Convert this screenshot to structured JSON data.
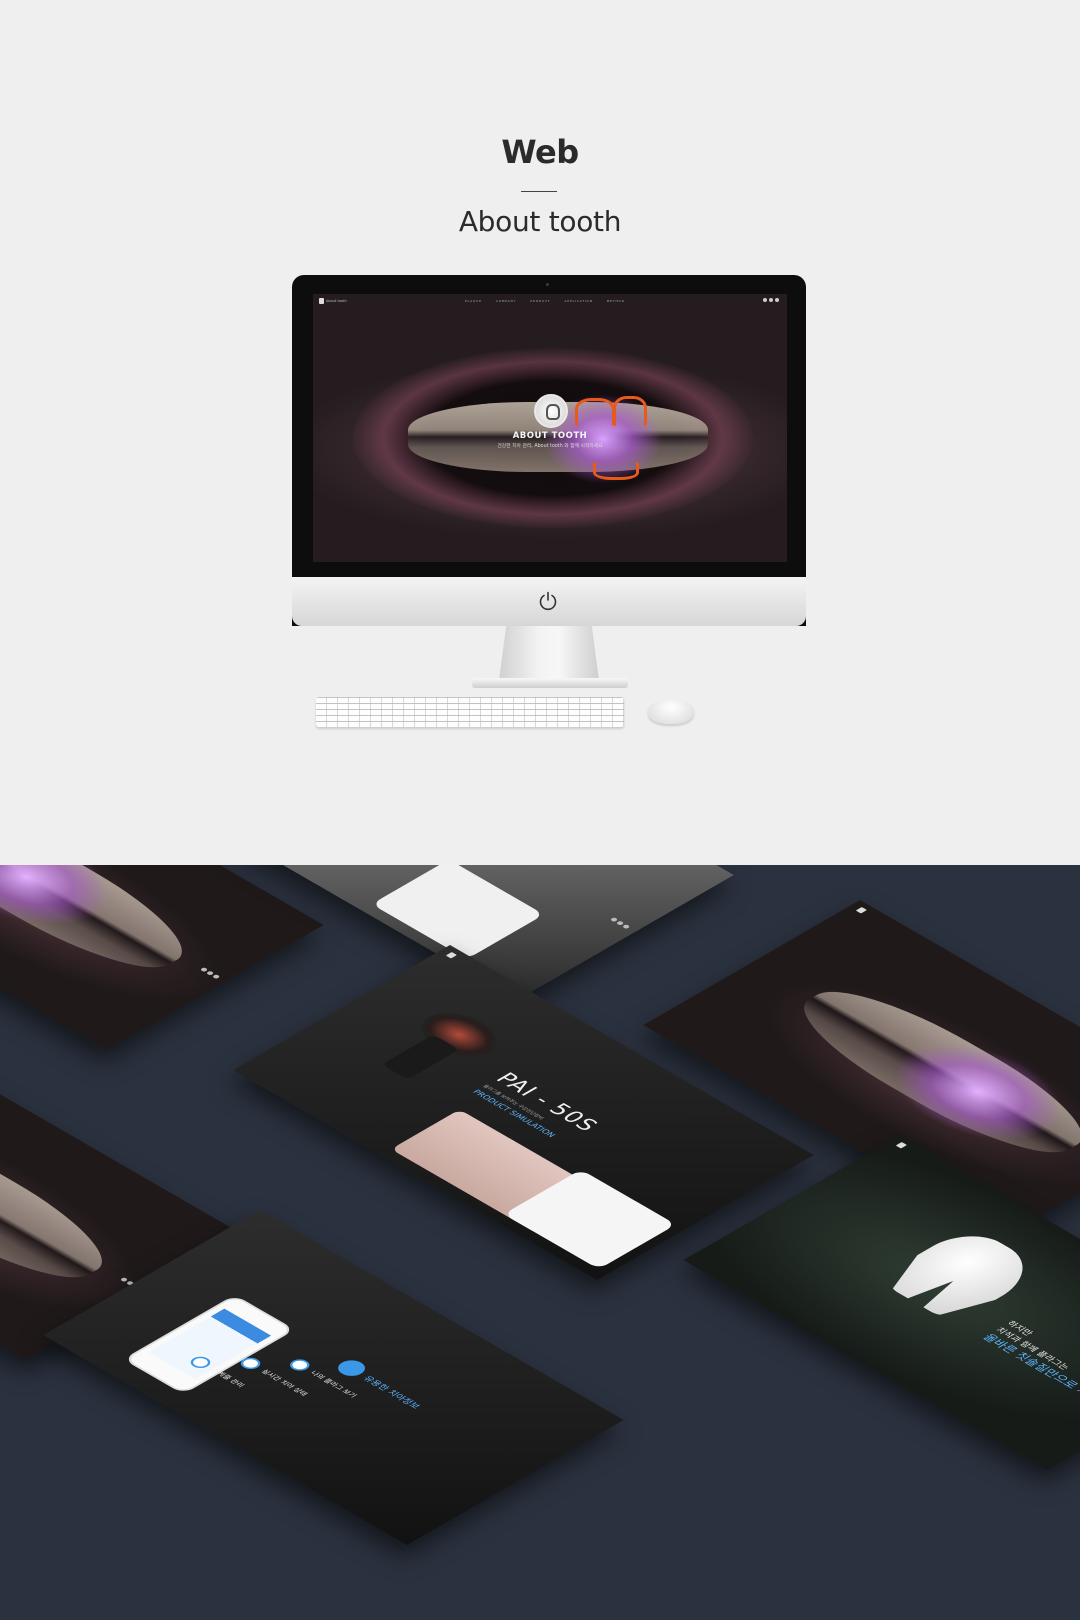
{
  "header": {
    "category": "Web",
    "project_title": "About tooth"
  },
  "screen": {
    "brand": "About tooth",
    "menu": [
      "PLAQUE",
      "COMPANY",
      "PRODUCT",
      "APPLICATION",
      "METHOD"
    ],
    "hero_title": "ABOUT TOOTH",
    "hero_subtitle": "건강한 치아 관리, About tooth 와 함께 시작하세요"
  },
  "mockups": {
    "product": {
      "title": "PAI - 50S",
      "subtitle": "플라그를 보여주는 구강진단장비",
      "simulation": "PRODUCT SIMULATION"
    },
    "app": {
      "items": [
        {
          "label": "유용한 치아정보",
          "highlight": true
        },
        {
          "label": "나의 플라그 보기",
          "highlight": false
        },
        {
          "label": "실시간 치아 상태",
          "highlight": false
        },
        {
          "label": "스케줄 관리",
          "highlight": false
        }
      ]
    },
    "tooth_page": {
      "line1": "하지만",
      "line2": "치석과 함께 플라그는",
      "line3": "올바른 칫솔질만으로 제거"
    }
  },
  "colors": {
    "page_bg": "#efefef",
    "mockup_bg": "#2b323f",
    "accent_blue": "#5db5ff",
    "plaque_orange": "#e85a1a"
  },
  "icons": [
    "power-icon",
    "tooth-logo-icon",
    "facebook-icon",
    "twitter-icon",
    "instagram-icon"
  ]
}
